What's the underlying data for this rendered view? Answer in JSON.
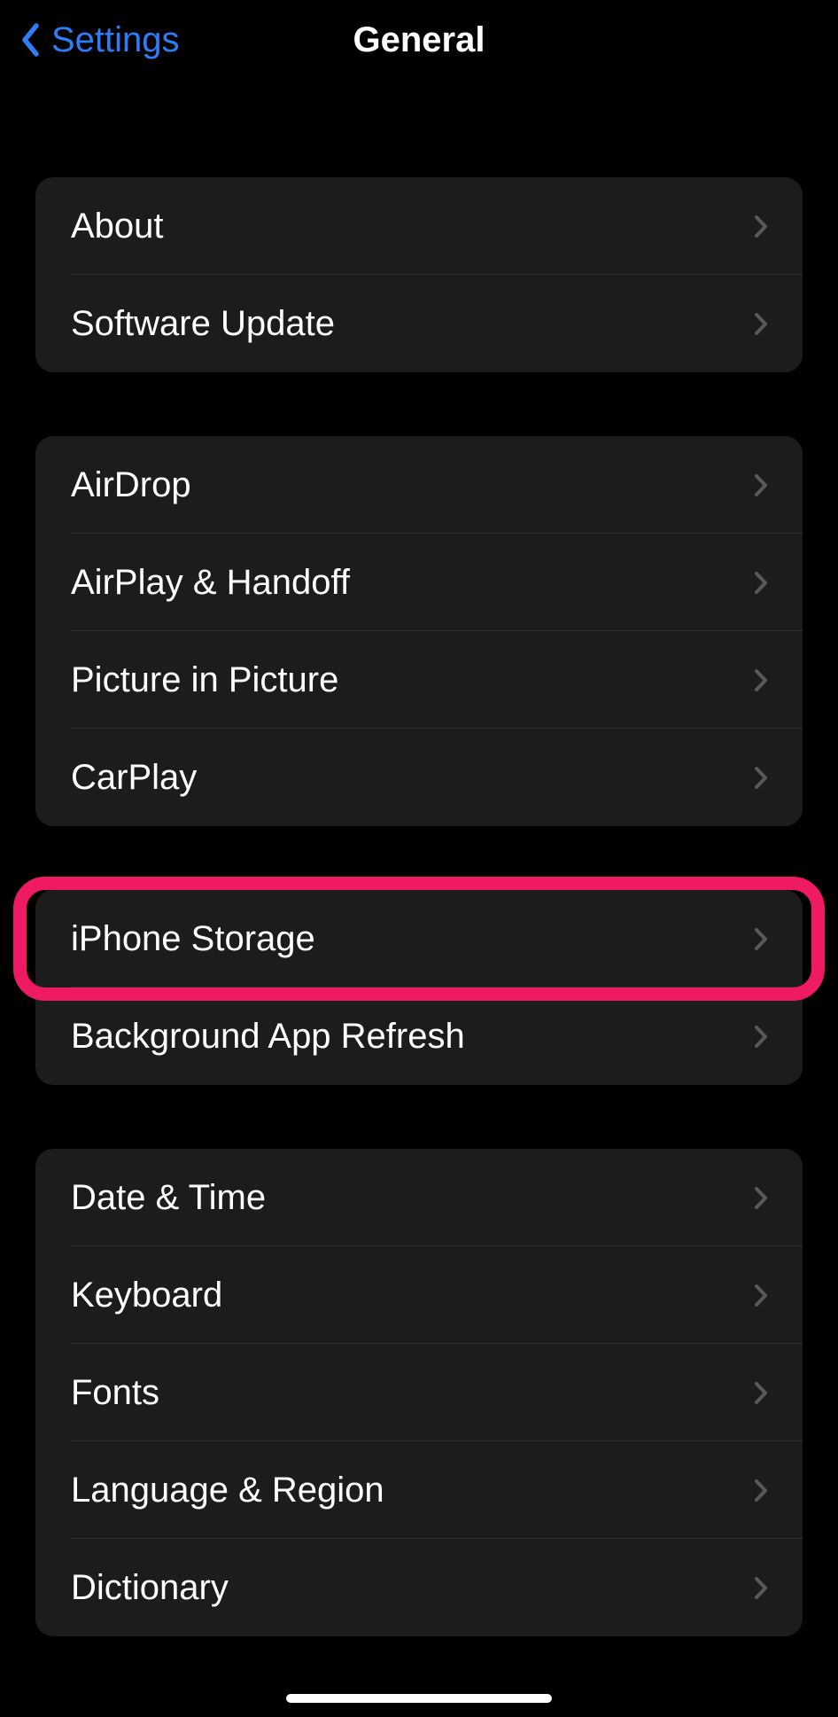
{
  "nav": {
    "back_label": "Settings",
    "title": "General"
  },
  "groups": [
    {
      "name": "group-about",
      "items": [
        {
          "label": "About",
          "name": "row-about"
        },
        {
          "label": "Software Update",
          "name": "row-software-update"
        }
      ]
    },
    {
      "name": "group-connectivity",
      "items": [
        {
          "label": "AirDrop",
          "name": "row-airdrop"
        },
        {
          "label": "AirPlay & Handoff",
          "name": "row-airplay-handoff"
        },
        {
          "label": "Picture in Picture",
          "name": "row-picture-in-picture"
        },
        {
          "label": "CarPlay",
          "name": "row-carplay"
        }
      ]
    },
    {
      "name": "group-storage",
      "highlighted_index": 0,
      "items": [
        {
          "label": "iPhone Storage",
          "name": "row-iphone-storage"
        },
        {
          "label": "Background App Refresh",
          "name": "row-background-app-refresh"
        }
      ]
    },
    {
      "name": "group-system",
      "items": [
        {
          "label": "Date & Time",
          "name": "row-date-time"
        },
        {
          "label": "Keyboard",
          "name": "row-keyboard"
        },
        {
          "label": "Fonts",
          "name": "row-fonts"
        },
        {
          "label": "Language & Region",
          "name": "row-language-region"
        },
        {
          "label": "Dictionary",
          "name": "row-dictionary"
        }
      ]
    }
  ],
  "colors": {
    "accent": "#2c7df6",
    "highlight": "#ee1a63",
    "group_bg": "#1c1c1e"
  }
}
